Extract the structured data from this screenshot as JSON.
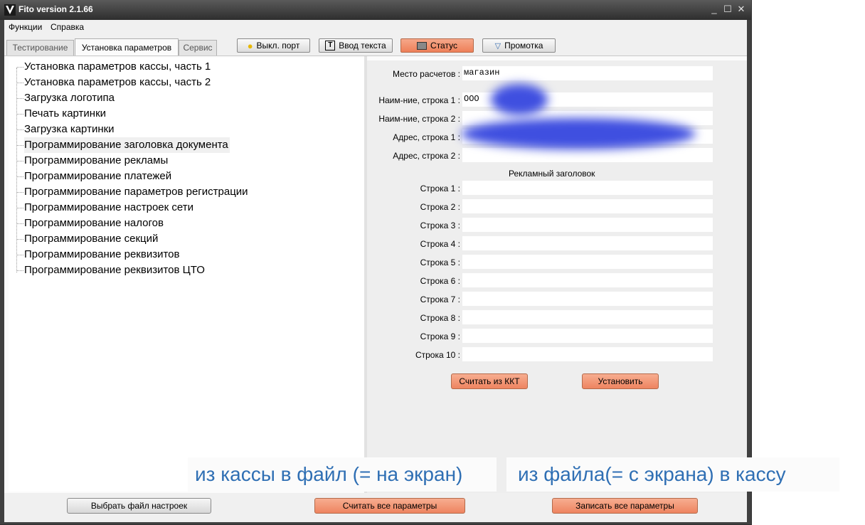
{
  "window": {
    "title": "Fito version 2.1.66",
    "controls": [
      "_",
      "☐",
      "✕"
    ]
  },
  "menu": [
    "Функции",
    "Справка"
  ],
  "tabs": [
    "Тестирование",
    "Установка параметров",
    "Сервис"
  ],
  "toolbar": {
    "port": "Выкл. порт",
    "text_input": "Ввод текста",
    "status": "Статус",
    "feed": "Промотка"
  },
  "tree_items": [
    "Установка параметров кассы, часть 1",
    "Установка параметров кассы, часть 2",
    "Загрузка логотипа",
    "Печать картинки",
    "Загрузка картинки",
    "Программирование заголовка документа",
    "Программирование рекламы",
    "Программирование платежей",
    "Программирование параметров регистрации",
    "Программирование настроек сети",
    "Программирование налогов",
    "Программирование секций",
    "Программирование реквизитов",
    "Программирование реквизитов ЦТО"
  ],
  "form": {
    "place": {
      "label": "Место расчетов :",
      "value": "магазин"
    },
    "name1": {
      "label": "Наим-ние, строка 1 :",
      "value": "ООО"
    },
    "name2": {
      "label": "Наим-ние, строка 2 :",
      "value": ""
    },
    "addr1": {
      "label": "Адрес, строка 1 :",
      "value": ""
    },
    "addr2": {
      "label": "Адрес, строка 2 :",
      "value": ""
    },
    "ad_header": "Рекламный заголовок",
    "ad_lines": [
      {
        "label": "Строка 1 :",
        "value": ""
      },
      {
        "label": "Строка 2 :",
        "value": ""
      },
      {
        "label": "Строка 3 :",
        "value": ""
      },
      {
        "label": "Строка 4 :",
        "value": ""
      },
      {
        "label": "Строка 5 :",
        "value": ""
      },
      {
        "label": "Строка 6 :",
        "value": ""
      },
      {
        "label": "Строка 7 :",
        "value": ""
      },
      {
        "label": "Строка 8 :",
        "value": ""
      },
      {
        "label": "Строка 9 :",
        "value": ""
      },
      {
        "label": "Строка 10 :",
        "value": ""
      }
    ],
    "read_btn": "Считать из ККТ",
    "set_btn": "Установить"
  },
  "bottom": {
    "choose_file": "Выбрать файл настроек",
    "read_all": "Считать все параметры",
    "write_all": "Записать все параметры"
  },
  "annotations": {
    "left": "из кассы в файл (= на экран)",
    "right": "из файла(= с экрана) в кассу"
  }
}
